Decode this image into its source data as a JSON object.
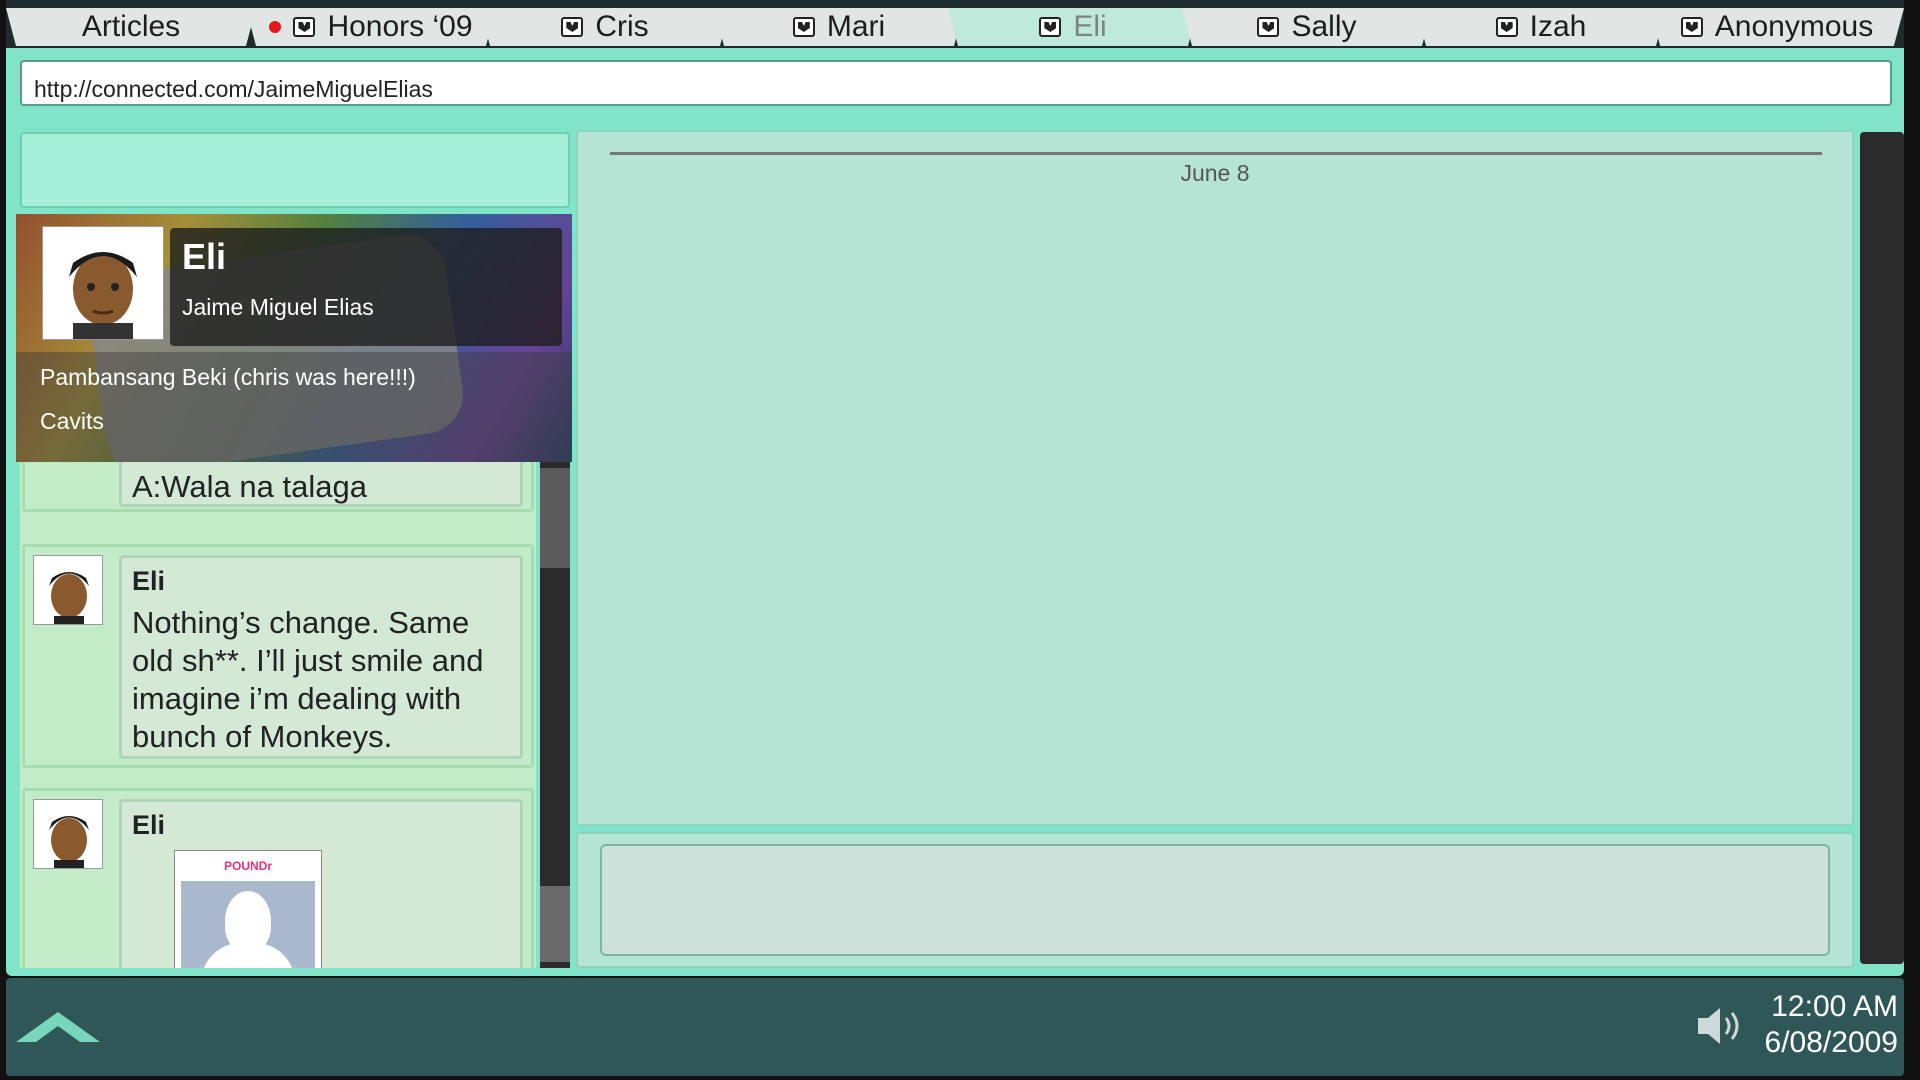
{
  "tabs": [
    {
      "label": "Articles",
      "active": false,
      "has_icon": false,
      "has_notification": false
    },
    {
      "label": "Honors ‘09",
      "active": false,
      "has_icon": true,
      "has_notification": true
    },
    {
      "label": "Cris",
      "active": false,
      "has_icon": true,
      "has_notification": false
    },
    {
      "label": "Mari",
      "active": false,
      "has_icon": true,
      "has_notification": false
    },
    {
      "label": "Eli",
      "active": true,
      "has_icon": true,
      "has_notification": false
    },
    {
      "label": "Sally",
      "active": false,
      "has_icon": true,
      "has_notification": false
    },
    {
      "label": "Izah",
      "active": false,
      "has_icon": true,
      "has_notification": false
    },
    {
      "label": "Anonymous",
      "active": false,
      "has_icon": true,
      "has_notification": false
    }
  ],
  "url": "http://connected.com/JaimeMiguelElias",
  "profile": {
    "name": "Eli",
    "full_name": "Jaime Miguel Elias",
    "line1": "Pambansang Beki (chris was here!!!)",
    "line2": "Cavits"
  },
  "feed": {
    "partial_text": "A:Wala na talaga",
    "posts": [
      {
        "name": "Eli",
        "text": "Nothing’s change. Same old sh**. I’ll just smile and imagine i’m dealing with bunch of Monkeys."
      },
      {
        "name": "Eli",
        "image_app_name": "POUNDr"
      }
    ]
  },
  "chat": {
    "date": "June 8"
  },
  "clock": {
    "time": "12:00 AM",
    "date": "6/08/2009"
  },
  "colors": {
    "app_bg": "#7fe4c8",
    "panel": "#b5e4d5",
    "taskbar": "#2f5758",
    "notification": "#e01b1b"
  },
  "icons": {
    "tab_icon": "chat-mask-icon",
    "home": "home-icon",
    "speaker": "speaker-icon"
  }
}
